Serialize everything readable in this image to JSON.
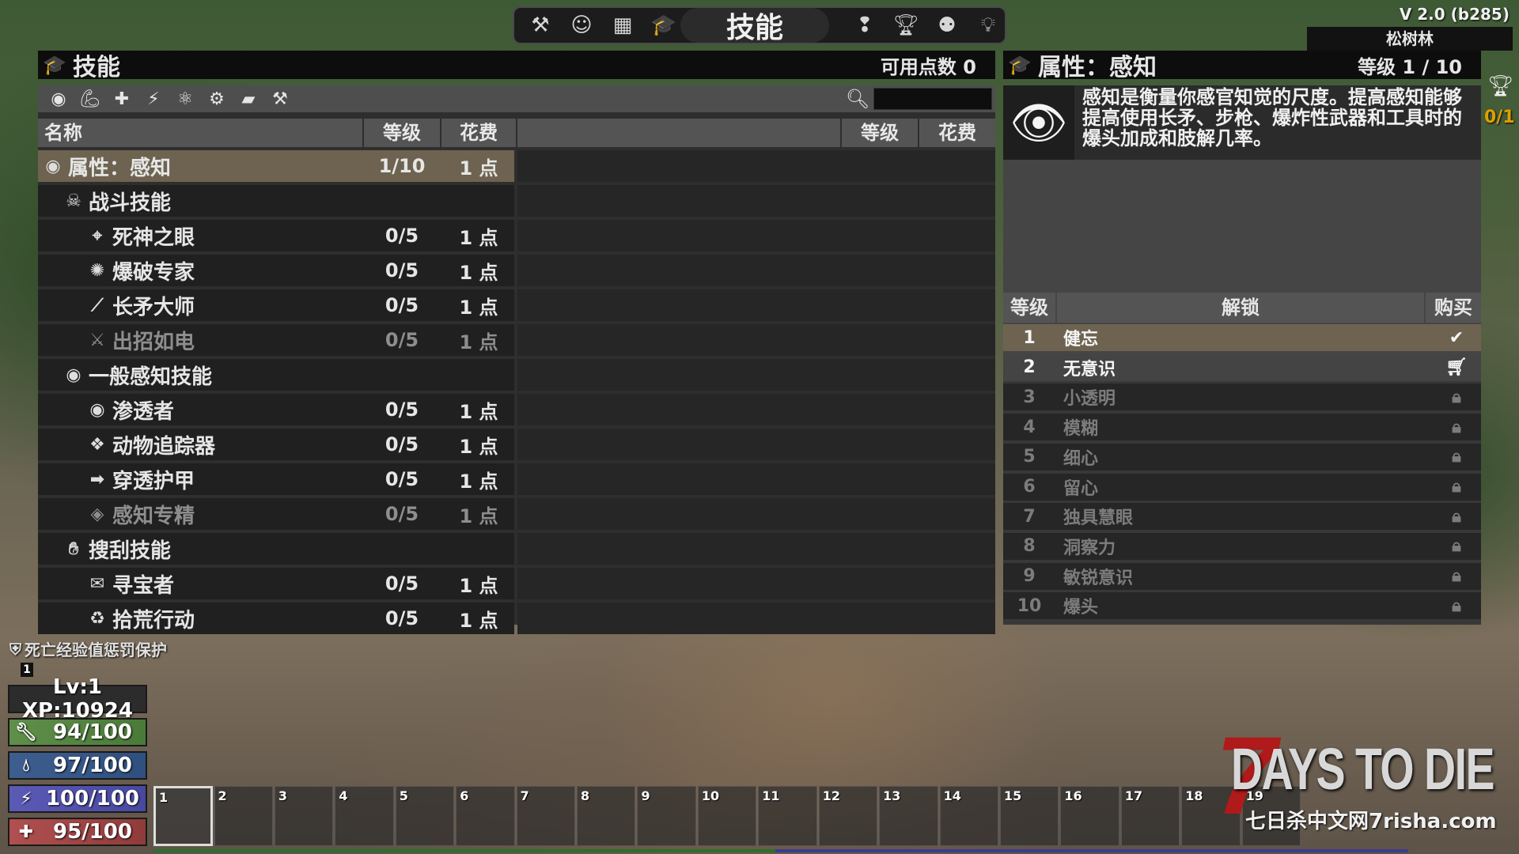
{
  "version": "V 2.0 (b285)",
  "biome": "松树林",
  "top_menu": {
    "left_icons": [
      "hammer-icon",
      "character-icon",
      "map-icon",
      "skills-icon"
    ],
    "title": "技能",
    "right_icons": [
      "quest-icon",
      "trophy-icon",
      "players-icon",
      "lightbulb-icon"
    ]
  },
  "skills_header": {
    "title": "技能",
    "points_label": "可用点数 0"
  },
  "toolbar_icons": [
    "eye-icon",
    "arm-icon",
    "plus-icon",
    "running-icon",
    "brain-icon",
    "gear-icon",
    "book-icon",
    "hammer-icon"
  ],
  "search": {
    "value": "",
    "placeholder": ""
  },
  "columns": {
    "name": "名称",
    "level": "等级",
    "cost": "花费",
    "level2": "等级",
    "cost2": "花费"
  },
  "skill_rows": [
    {
      "name": "属性：感知",
      "level": "1/10",
      "cost": "1 点",
      "type": "attr",
      "icon": "eye-icon",
      "indent": 0
    },
    {
      "name": "战斗技能",
      "level": "",
      "cost": "",
      "type": "group",
      "icon": "skull-icon",
      "indent": 1
    },
    {
      "name": "死神之眼",
      "level": "0/5",
      "cost": "1 点",
      "type": "skill",
      "icon": "crosshair-icon",
      "indent": 2
    },
    {
      "name": "爆破专家",
      "level": "0/5",
      "cost": "1 点",
      "type": "skill",
      "icon": "explosion-icon",
      "indent": 2
    },
    {
      "name": "长矛大师",
      "level": "0/5",
      "cost": "1 点",
      "type": "skill",
      "icon": "spear-icon",
      "indent": 2
    },
    {
      "name": "出招如电",
      "level": "0/5",
      "cost": "1 点",
      "type": "locked",
      "icon": "swords-icon",
      "indent": 2
    },
    {
      "name": "一般感知技能",
      "level": "",
      "cost": "",
      "type": "group",
      "icon": "eye-icon",
      "indent": 1
    },
    {
      "name": "渗透者",
      "level": "0/5",
      "cost": "1 点",
      "type": "skill",
      "icon": "eye-icon",
      "indent": 2
    },
    {
      "name": "动物追踪器",
      "level": "0/5",
      "cost": "1 点",
      "type": "skill",
      "icon": "paw-icon",
      "indent": 2
    },
    {
      "name": "穿透护甲",
      "level": "0/5",
      "cost": "1 点",
      "type": "skill",
      "icon": "penetrate-icon",
      "indent": 2
    },
    {
      "name": "感知专精",
      "level": "0/5",
      "cost": "1 点",
      "type": "locked",
      "icon": "gem-icon",
      "indent": 2
    },
    {
      "name": "搜刮技能",
      "level": "",
      "cost": "",
      "type": "group",
      "icon": "hand-icon",
      "indent": 1
    },
    {
      "name": "寻宝者",
      "level": "0/5",
      "cost": "1 点",
      "type": "skill",
      "icon": "treasure-icon",
      "indent": 2
    },
    {
      "name": "拾荒行动",
      "level": "0/5",
      "cost": "1 点",
      "type": "skill",
      "icon": "recycle-icon",
      "indent": 2
    }
  ],
  "attr_header": {
    "title": "属性：感知",
    "level_label": "等级 1 / 10"
  },
  "attr_description": "感知是衡量你感官知觉的尺度。提高感知能够提高使用长矛、步枪、爆炸性武器和工具时的爆头加成和肢解几率。",
  "unlock_columns": {
    "level": "等级",
    "unlock": "解锁",
    "buy": "购买"
  },
  "unlocks": [
    {
      "level": "1",
      "name": "健忘",
      "status": "done",
      "icon": "check-icon"
    },
    {
      "level": "2",
      "name": "无意识",
      "status": "avail",
      "icon": "cart-icon"
    },
    {
      "level": "3",
      "name": "小透明",
      "status": "locked",
      "icon": "lock-icon"
    },
    {
      "level": "4",
      "name": "模糊",
      "status": "locked",
      "icon": "lock-icon"
    },
    {
      "level": "5",
      "name": "细心",
      "status": "locked",
      "icon": "lock-icon"
    },
    {
      "level": "6",
      "name": "留心",
      "status": "locked",
      "icon": "lock-icon"
    },
    {
      "level": "7",
      "name": "独具慧眼",
      "status": "locked",
      "icon": "lock-icon"
    },
    {
      "level": "8",
      "name": "洞察力",
      "status": "locked",
      "icon": "lock-icon"
    },
    {
      "level": "9",
      "name": "敏锐意识",
      "status": "locked",
      "icon": "lock-icon"
    },
    {
      "level": "10",
      "name": "爆头",
      "status": "locked",
      "icon": "lock-icon"
    }
  ],
  "hud": {
    "death_protection": "死亡经验值惩罚保护",
    "death_count": "1",
    "level_xp": "Lv:1 XP:10924",
    "stamina": "94/100",
    "water": "97/100",
    "food": "100/100",
    "health": "95/100"
  },
  "toolbelt": [
    "1",
    "2",
    "3",
    "4",
    "5",
    "6",
    "7",
    "8",
    "9",
    "10",
    "11",
    "12",
    "13",
    "14",
    "15",
    "16",
    "17",
    "18",
    "19"
  ],
  "edge_text": "0/1",
  "watermark": {
    "main": "DAYS TO DIE",
    "seven": "7",
    "sub": "七日杀中文网7risha.com"
  }
}
